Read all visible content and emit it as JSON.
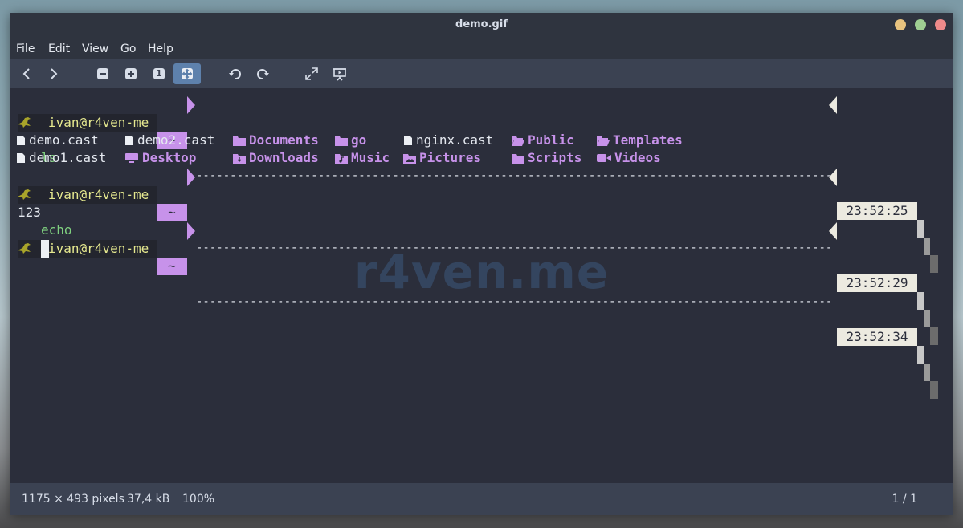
{
  "window": {
    "title": "demo.gif",
    "buttons": {
      "minimize_color": "#e8c37f",
      "maximize_color": "#9fcf92",
      "close_color": "#ee8a8a"
    }
  },
  "menu": [
    "File",
    "Edit",
    "View",
    "Go",
    "Help"
  ],
  "toolbar": {
    "icons": [
      "back-icon",
      "forward-icon",
      "zoom-out-icon",
      "zoom-in-icon",
      "zoom-original-icon",
      "zoom-fit-icon",
      "rotate-left-icon",
      "rotate-right-icon",
      "fullscreen-icon",
      "slideshow-icon"
    ],
    "zoom_original_label": "1"
  },
  "terminal": {
    "prompts": [
      {
        "user": "ivan@r4ven-me",
        "dir": "~",
        "time": "23:52:25",
        "command": "ls"
      },
      {
        "user": "ivan@r4ven-me",
        "dir": "~",
        "time": "23:52:29",
        "command": "echo",
        "arg": " 123"
      },
      {
        "user": "ivan@r4ven-me",
        "dir": "~",
        "time": "23:52:34",
        "command": ""
      }
    ],
    "ls_row1": [
      {
        "name": "demo.cast",
        "kind": "file"
      },
      {
        "name": "demo2.cast",
        "kind": "file"
      },
      {
        "name": "Documents",
        "kind": "dir"
      },
      {
        "name": "go",
        "kind": "dir"
      },
      {
        "name": "nginx.cast",
        "kind": "file"
      },
      {
        "name": "Public",
        "kind": "dir"
      },
      {
        "name": "Templates",
        "kind": "dir"
      }
    ],
    "ls_row2": [
      {
        "name": "demo1.cast",
        "kind": "file"
      },
      {
        "name": "Desktop",
        "kind": "dir"
      },
      {
        "name": "Downloads",
        "kind": "dir"
      },
      {
        "name": "Music",
        "kind": "dir"
      },
      {
        "name": "Pictures",
        "kind": "dir"
      },
      {
        "name": "Scripts",
        "kind": "dir"
      },
      {
        "name": "Videos",
        "kind": "dir"
      }
    ],
    "echo_output": "123",
    "watermark": "r4ven.me",
    "colors": {
      "dir": "#c792ea",
      "user": "#e5e88f",
      "command": "#7fd07f",
      "bird": "#a8a42a"
    }
  },
  "status": {
    "dimensions": "1175 × 493 pixels",
    "size": "37,4 kB",
    "zoom": "100%",
    "page": "1 / 1"
  }
}
